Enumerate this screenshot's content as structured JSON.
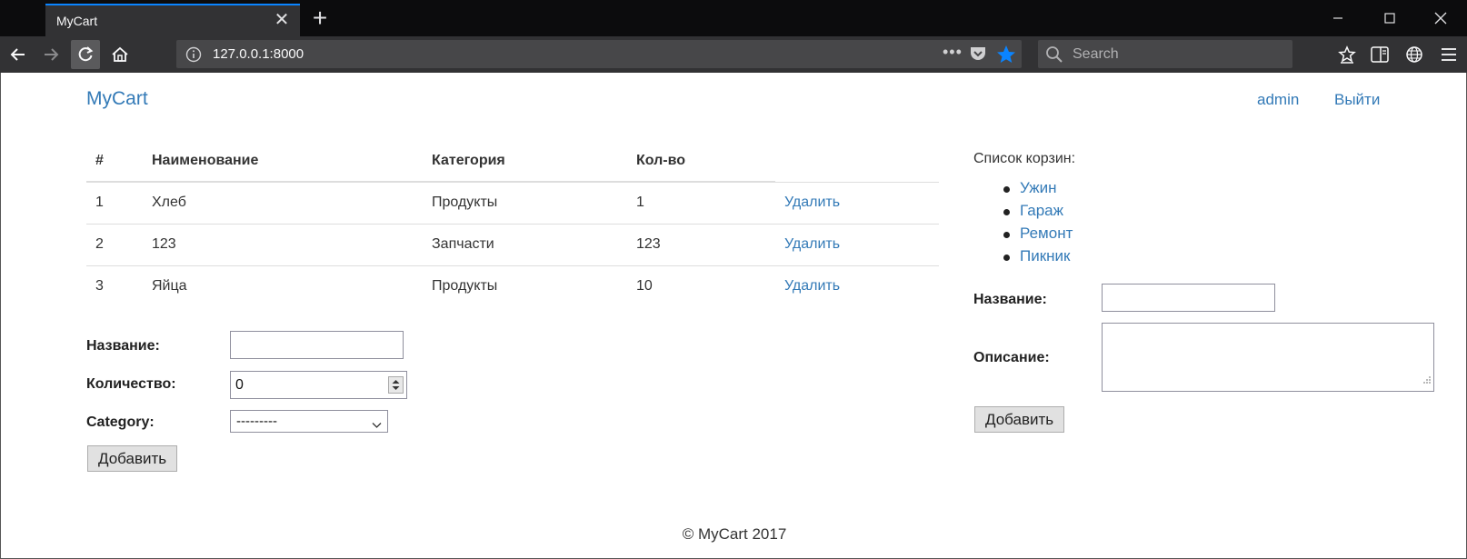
{
  "browser": {
    "tab_title": "MyCart",
    "url": "127.0.0.1:8000",
    "search_placeholder": "Search",
    "url_more": "•••"
  },
  "header": {
    "brand": "MyCart",
    "user": "admin",
    "logout": "Выйти"
  },
  "items_table": {
    "headers": [
      "#",
      "Наименование",
      "Категория",
      "Кол-во"
    ],
    "delete_label": "Удалить",
    "rows": [
      {
        "num": "1",
        "name": "Хлеб",
        "category": "Продукты",
        "qty": "1"
      },
      {
        "num": "2",
        "name": "123",
        "category": "Запчасти",
        "qty": "123"
      },
      {
        "num": "3",
        "name": "Яйца",
        "category": "Продукты",
        "qty": "10"
      }
    ]
  },
  "item_form": {
    "name_label": "Название:",
    "name_value": "",
    "qty_label": "Количество:",
    "qty_value": "0",
    "category_label": "Category:",
    "category_selected": "---------",
    "submit_label": "Добавить"
  },
  "carts": {
    "title": "Список корзин:",
    "items": [
      "Ужин",
      "Гараж",
      "Ремонт",
      "Пикник"
    ]
  },
  "cart_form": {
    "name_label": "Название:",
    "name_value": "",
    "description_label": "Описание:",
    "description_value": "",
    "submit_label": "Добавить"
  },
  "footer": {
    "text": "© MyCart 2017"
  },
  "colors": {
    "link": "#337ab7",
    "accent": "#0a84ff"
  }
}
